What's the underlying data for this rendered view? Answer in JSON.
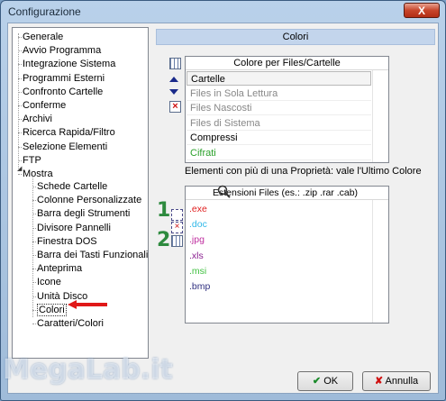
{
  "window": {
    "title": "Configurazione",
    "close_label": "X"
  },
  "tree": {
    "items": [
      {
        "label": "Generale"
      },
      {
        "label": "Avvio Programma"
      },
      {
        "label": "Integrazione Sistema"
      },
      {
        "label": "Programmi Esterni"
      },
      {
        "label": "Confronto Cartelle"
      },
      {
        "label": "Conferme"
      },
      {
        "label": "Archivi"
      },
      {
        "label": "Ricerca Rapida/Filtro"
      },
      {
        "label": "Selezione Elementi"
      },
      {
        "label": "FTP"
      },
      {
        "label": "Mostra"
      }
    ],
    "children": [
      {
        "label": "Schede Cartelle"
      },
      {
        "label": "Colonne Personalizzate"
      },
      {
        "label": "Barra degli Strumenti"
      },
      {
        "label": "Divisore Pannelli"
      },
      {
        "label": "Finestra DOS"
      },
      {
        "label": "Barra dei Tasti Funzionali"
      },
      {
        "label": "Anteprima"
      },
      {
        "label": "Icone"
      },
      {
        "label": "Unità Disco"
      },
      {
        "label": "Colori"
      },
      {
        "label": "Caratteri/Colori"
      }
    ]
  },
  "panel": {
    "header": "Colori",
    "list1_title": "Colore per Files/Cartelle",
    "list1_rows": [
      {
        "label": "Cartelle",
        "color": "#000000"
      },
      {
        "label": "Files in Sola Lettura",
        "color": "#888888"
      },
      {
        "label": "Files Nascosti",
        "color": "#888888"
      },
      {
        "label": "Files di Sistema",
        "color": "#888888"
      },
      {
        "label": "Compressi",
        "color": "#000000"
      },
      {
        "label": "Cifrati",
        "color": "#2aa02a"
      }
    ],
    "note": "Elementi con più di una Proprietà: vale l'Ultimo Colore",
    "list2_title": "Estensioni Files (es.: .zip .rar .cab)",
    "extensions": [
      {
        "label": ".exe",
        "color": "#e02020"
      },
      {
        "label": ".doc",
        "color": "#30b8e8"
      },
      {
        "label": ".jpg",
        "color": "#c030a0"
      },
      {
        "label": ".xls",
        "color": "#8a2090"
      },
      {
        "label": ".msi",
        "color": "#40c040"
      },
      {
        "label": ".bmp",
        "color": "#303080"
      }
    ],
    "annotations": [
      "1",
      "2"
    ]
  },
  "buttons": {
    "ok": "OK",
    "cancel": "Annulla"
  },
  "watermark": "MegaLab.it"
}
